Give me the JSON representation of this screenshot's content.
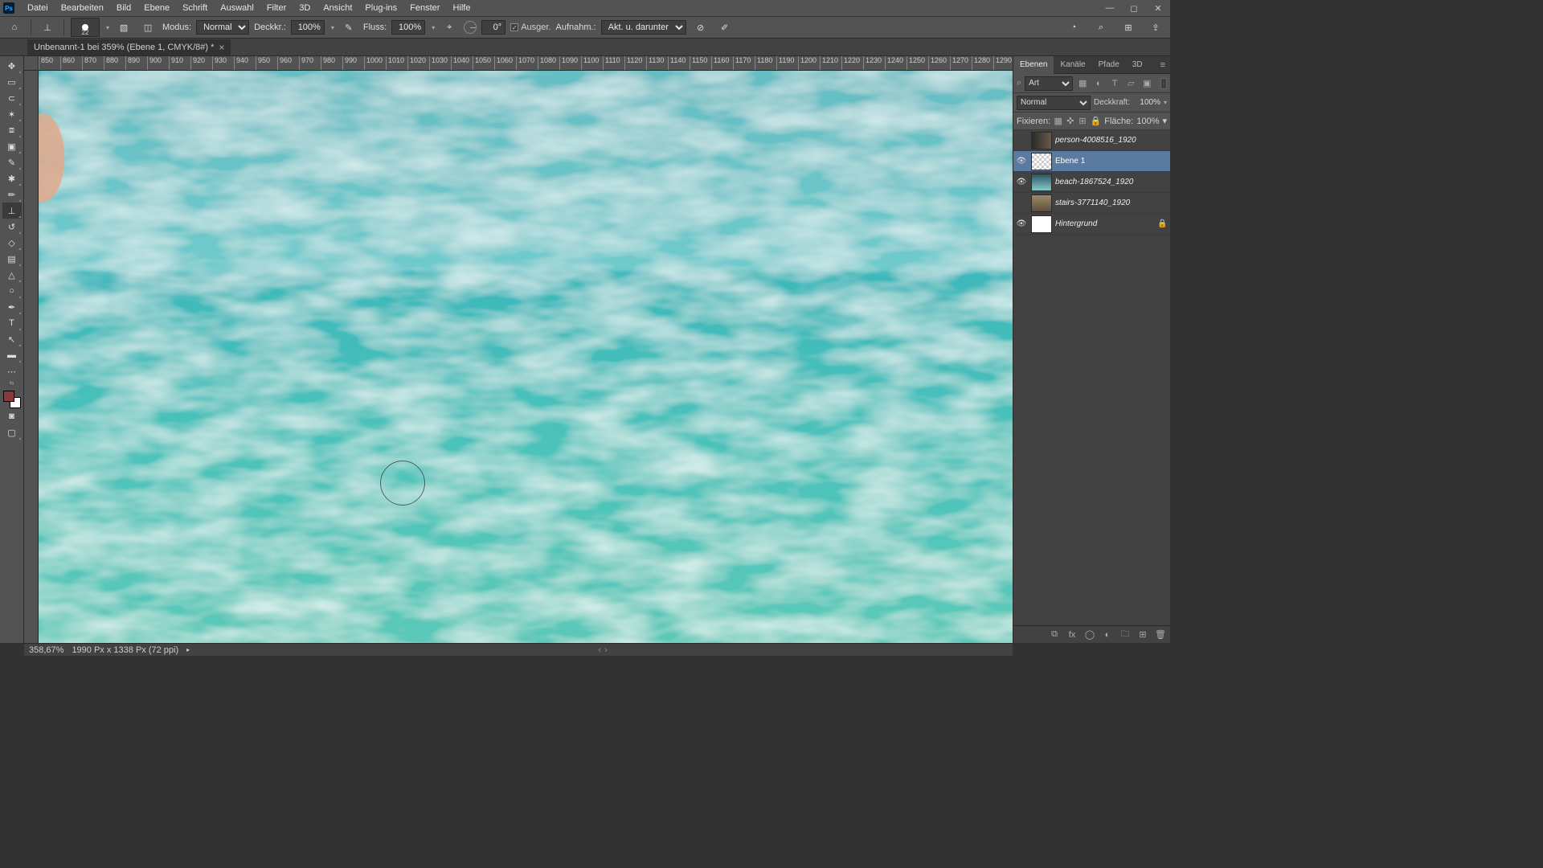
{
  "menubar": {
    "items": [
      "Datei",
      "Bearbeiten",
      "Bild",
      "Ebene",
      "Schrift",
      "Auswahl",
      "Filter",
      "3D",
      "Ansicht",
      "Plug-ins",
      "Fenster",
      "Hilfe"
    ]
  },
  "optionsbar": {
    "brush_size": "22",
    "mode_label": "Modus:",
    "mode_value": "Normal",
    "opacity_label": "Deckkr.:",
    "opacity_value": "100%",
    "flow_label": "Fluss:",
    "flow_value": "100%",
    "angle_value": "0°",
    "aligned_label": "Ausger.",
    "sample_label": "Aufnahm.:",
    "sample_value": "Akt. u. darunter"
  },
  "doctab": {
    "title": "Unbenannt-1 bei 359% (Ebene 1, CMYK/8#) *"
  },
  "ruler_h": [
    "850",
    "860",
    "870",
    "880",
    "890",
    "900",
    "910",
    "920",
    "930",
    "940",
    "950",
    "960",
    "970",
    "980",
    "990",
    "1000",
    "1010",
    "1020",
    "1030",
    "1040",
    "1050",
    "1060",
    "1070",
    "1080",
    "1090",
    "1100",
    "1110",
    "1120",
    "1130",
    "1140",
    "1150",
    "1160",
    "1170",
    "1180",
    "1190",
    "1200",
    "1210",
    "1220",
    "1230",
    "1240",
    "1250",
    "1260",
    "1270",
    "1280",
    "1290"
  ],
  "panels": {
    "tabs": [
      "Ebenen",
      "Kanäle",
      "Pfade",
      "3D"
    ],
    "search_mode": "Art",
    "blend_mode": "Normal",
    "opacity_label": "Deckkraft:",
    "opacity_value": "100%",
    "lock_label": "Fixieren:",
    "fill_label": "Fläche:",
    "fill_value": "100%",
    "layers": [
      {
        "visible": false,
        "name": "person-4008516_1920",
        "thumb": "img0"
      },
      {
        "visible": true,
        "name": "Ebene 1",
        "thumb": "trans",
        "selected": true
      },
      {
        "visible": true,
        "name": "beach-1867524_1920",
        "thumb": "img1"
      },
      {
        "visible": false,
        "name": "stairs-3771140_1920",
        "thumb": "img2"
      },
      {
        "visible": true,
        "name": "Hintergrund",
        "thumb": "white",
        "locked": true
      }
    ]
  },
  "statusbar": {
    "zoom": "358,67%",
    "docinfo": "1990 Px x 1338 Px (72 ppi)"
  }
}
